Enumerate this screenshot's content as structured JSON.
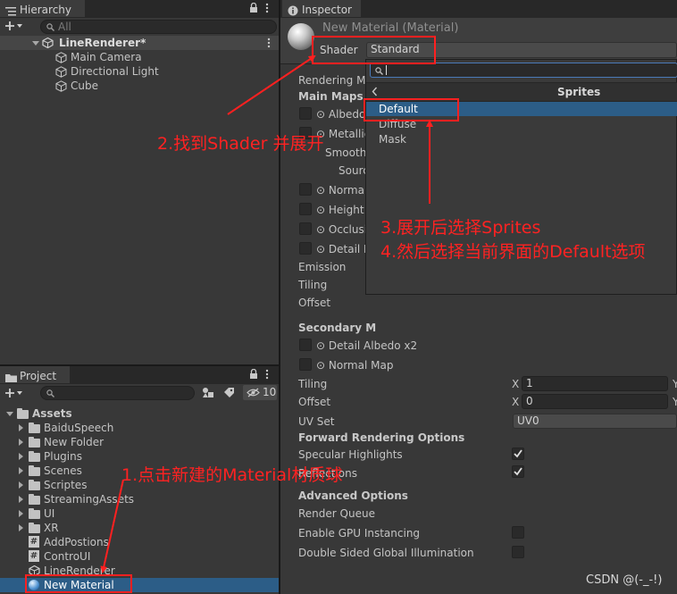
{
  "hierarchy": {
    "tab_label": "Hierarchy",
    "search_placeholder": "All",
    "scene_name": "LineRenderer*",
    "objects": [
      "Main Camera",
      "Directional Light",
      "Cube"
    ]
  },
  "project": {
    "tab_label": "Project",
    "hidden_count": "10",
    "root_folder": "Assets",
    "folders": [
      "BaiduSpeech",
      "New Folder",
      "Plugins",
      "Scenes",
      "Scriptes",
      "StreamingAssets",
      "UI",
      "XR"
    ],
    "scripts": [
      "AddPostions",
      "ControUI"
    ],
    "scene_asset": "LineRenderer",
    "selected_asset": "New Material"
  },
  "inspector": {
    "tab_label": "Inspector",
    "material_title": "New Material (Material)",
    "shader_label": "Shader",
    "shader_value": "Standard",
    "rendering_mode": "Rendering Mo",
    "main_maps": "Main Maps",
    "albedo": "Albedo",
    "metallic": "Metallic",
    "smoothness": "Smoothn",
    "source": "Sourc",
    "normal": "Normal I",
    "height": "Height M",
    "occlusion": "Occlusio",
    "detail": "Detail M",
    "emission": "Emission",
    "tiling": "Tiling",
    "offset": "Offset",
    "secondary_maps": "Secondary M",
    "detail_albedo": "Detail Albedo x2",
    "normal_map": "Normal Map",
    "tiling2": "Tiling",
    "offset2": "Offset",
    "x_label": "X",
    "y_label": "Y",
    "tiling_x": "1",
    "offset_x": "0",
    "uv_set": "UV Set",
    "uv_value": "UV0",
    "forward_opts": "Forward Rendering Options",
    "specular": "Specular Highlights",
    "reflections": "Reflections",
    "advanced_opts": "Advanced Options",
    "render_queue": "Render Queue",
    "gpu_instancing": "Enable GPU Instancing",
    "double_gi": "Double Sided Global Illumination"
  },
  "shader_dropdown": {
    "header": "Sprites",
    "items": [
      "Default",
      "Diffuse",
      "Mask"
    ],
    "selected": "Default"
  },
  "annotations": {
    "step1": "1.点击新建的Material材质球",
    "step2": "2.找到Shader 并展开",
    "step3": "3.展开后选择Sprites",
    "step4": "4.然后选择当前界面的Default选项",
    "watermark": "CSDN @(-_-!)"
  },
  "colors": {
    "annotation": "#ff2020",
    "selection": "#2c5d87",
    "panel": "#383838"
  }
}
